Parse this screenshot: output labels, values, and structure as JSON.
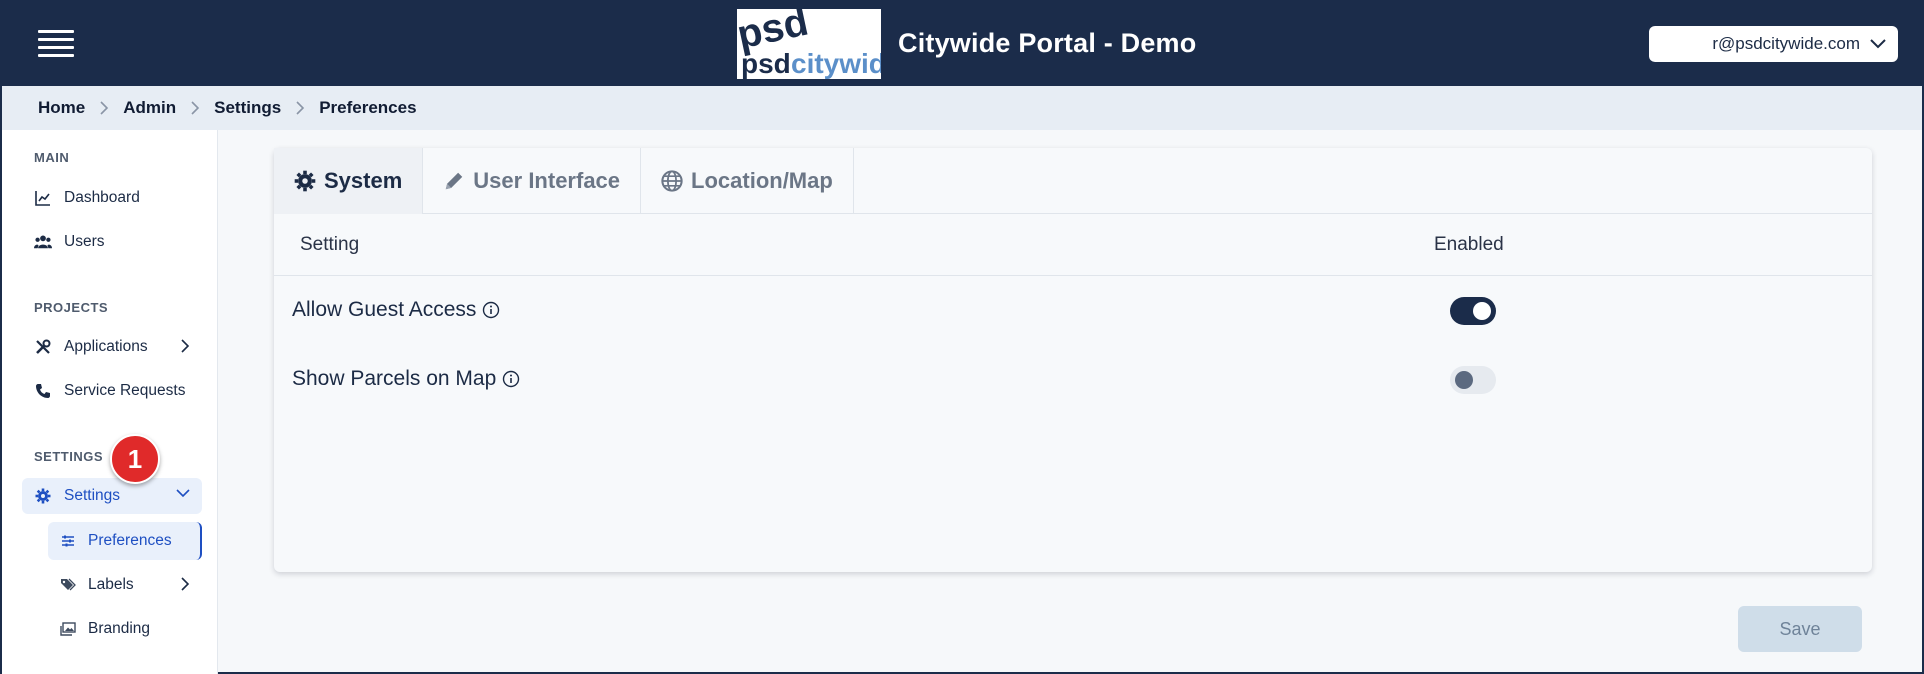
{
  "header": {
    "logo_text_top": "psd",
    "logo_text_bottom_left": "psd",
    "logo_text_bottom_right": "citywide",
    "title": "Citywide Portal - Demo",
    "user_email": "r@psdcitywide.com",
    "menu_icon": "hamburger-icon",
    "user_chevron_icon": "chevron-down-icon"
  },
  "breadcrumb": [
    "Home",
    "Admin",
    "Settings",
    "Preferences"
  ],
  "sidebar": {
    "sections": [
      {
        "label": "MAIN"
      },
      {
        "label": "PROJECTS"
      },
      {
        "label": "SETTINGS"
      }
    ],
    "items": [
      {
        "label": "Dashboard",
        "icon": "chart-line-icon"
      },
      {
        "label": "Users",
        "icon": "users-icon"
      },
      {
        "label": "Applications",
        "icon": "tools-icon"
      },
      {
        "label": "Service Requests",
        "icon": "phone-icon"
      },
      {
        "label": "Settings",
        "icon": "gear-icon"
      }
    ],
    "subitems": [
      {
        "label": "Preferences",
        "icon": "sliders-icon"
      },
      {
        "label": "Labels",
        "icon": "tags-icon"
      },
      {
        "label": "Branding",
        "icon": "images-icon"
      }
    ],
    "step_badge": "1"
  },
  "tabs": [
    {
      "label": "System",
      "icon": "gear-icon",
      "active": true
    },
    {
      "label": "User Interface",
      "icon": "pencil-icon",
      "active": false
    },
    {
      "label": "Location/Map",
      "icon": "globe-icon",
      "active": false
    }
  ],
  "table": {
    "col_setting": "Setting",
    "col_enabled": "Enabled",
    "rows": [
      {
        "label": "Allow Guest Access",
        "enabled": true
      },
      {
        "label": "Show Parcels on Map",
        "enabled": false
      }
    ]
  },
  "actions": {
    "save_label": "Save"
  },
  "colors": {
    "header_bg": "#1b2c4a",
    "accent": "#1e4fc2",
    "badge": "#e02a2a",
    "toggle_on": "#1b2c4a"
  }
}
